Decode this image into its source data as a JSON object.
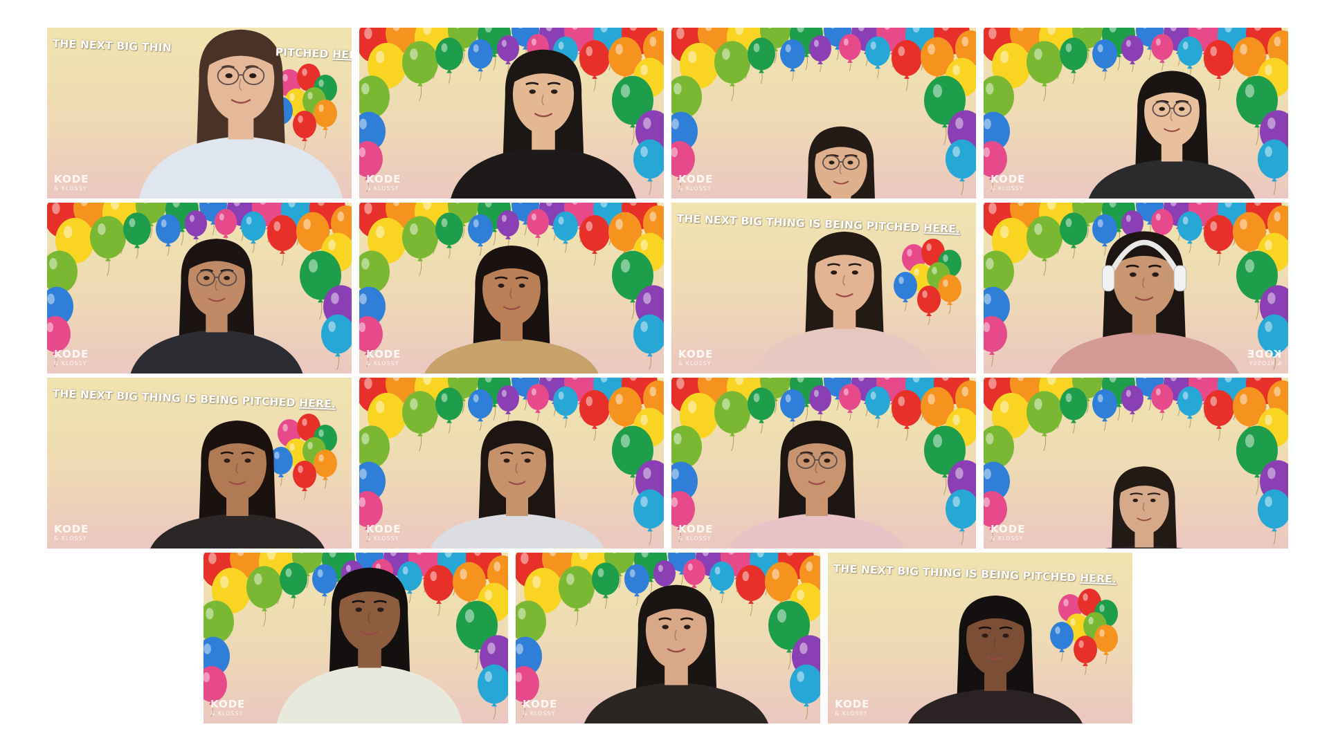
{
  "meeting": {
    "tagline": "THE NEXT BIG THING IS BEING PITCHED",
    "tagline_emphasis": "HERE.",
    "tagline_partial_left": "THE NEXT BIG THIN",
    "tagline_partial_right": "PITCHED",
    "brand_name": "KODE",
    "brand_sub": "& KLOSSY"
  },
  "colors": {
    "background_top": "#f0e4b0",
    "background_bottom": "#ebc7c1",
    "balloons": [
      "#e8302a",
      "#f6931f",
      "#f9d423",
      "#7ab833",
      "#1e9e4a",
      "#2f7fd8",
      "#8a3fb5",
      "#e64a8a",
      "#27a7d6"
    ]
  },
  "participants": [
    {
      "id": 1,
      "background": "tagline-cluster",
      "tagline_variant": "partial",
      "hair": "#4a3326",
      "skin": "#e6b89a",
      "shirt": "#dfe6ee",
      "glasses": true
    },
    {
      "id": 2,
      "background": "balloon-arch",
      "hair": "#1c1614",
      "skin": "#e3b892",
      "shirt": "#1e1a1a",
      "glasses": false
    },
    {
      "id": 3,
      "background": "balloon-arch",
      "hair": "#241b17",
      "skin": "#dfb08e",
      "shirt": "#2a2220",
      "glasses": true
    },
    {
      "id": 4,
      "background": "balloon-arch",
      "hair": "#1a1513",
      "skin": "#e9c09e",
      "shirt": "#2b2b2e",
      "glasses": true
    },
    {
      "id": 5,
      "background": "balloon-arch",
      "hair": "#1b1412",
      "skin": "#c08a66",
      "shirt": "#2c2c33",
      "glasses": true
    },
    {
      "id": 6,
      "background": "balloon-arch",
      "hair": "#1a1210",
      "skin": "#b98058",
      "shirt": "#c7a36b",
      "glasses": false
    },
    {
      "id": 7,
      "background": "tagline-cluster",
      "tagline_variant": "full",
      "hair": "#241a14",
      "skin": "#e2b493",
      "shirt": "#e6c8c1",
      "glasses": false
    },
    {
      "id": 8,
      "background": "balloon-arch",
      "mirrored_brand": true,
      "hair": "#1d1512",
      "skin": "#c99672",
      "shirt": "#d49a96",
      "glasses": false,
      "headphones": true
    },
    {
      "id": 9,
      "background": "tagline-cluster",
      "tagline_variant": "full",
      "hair": "#1b1210",
      "skin": "#b07a55",
      "shirt": "#2d2626",
      "glasses": false
    },
    {
      "id": 10,
      "background": "balloon-arch",
      "hair": "#1c1512",
      "skin": "#c5926c",
      "shirt": "#dcdde3",
      "glasses": false
    },
    {
      "id": 11,
      "background": "balloon-arch",
      "hair": "#1e1612",
      "skin": "#c99470",
      "shirt": "#e9c2c7",
      "glasses": true
    },
    {
      "id": 12,
      "background": "balloon-arch",
      "hair": "#231a15",
      "skin": "#d6a98a",
      "shirt": "#2b2523",
      "glasses": false
    },
    {
      "id": 13,
      "background": "balloon-arch",
      "hair": "#141010",
      "skin": "#8e5c3e",
      "shirt": "#e9e8dc",
      "glasses": false
    },
    {
      "id": 14,
      "background": "balloon-arch",
      "hair": "#1a1412",
      "skin": "#d9a888",
      "shirt": "#2b2523",
      "glasses": false
    },
    {
      "id": 15,
      "background": "tagline-cluster",
      "tagline_variant": "full",
      "hair": "#141010",
      "skin": "#7d4e36",
      "shirt": "#2b2224",
      "glasses": false
    }
  ]
}
